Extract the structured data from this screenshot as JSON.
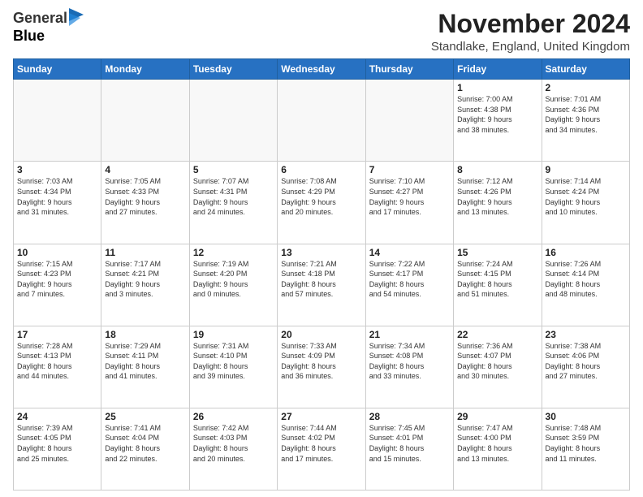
{
  "logo": {
    "general": "General",
    "blue": "Blue"
  },
  "title": "November 2024",
  "location": "Standlake, England, United Kingdom",
  "days_of_week": [
    "Sunday",
    "Monday",
    "Tuesday",
    "Wednesday",
    "Thursday",
    "Friday",
    "Saturday"
  ],
  "weeks": [
    [
      {
        "day": "",
        "info": "",
        "empty": true
      },
      {
        "day": "",
        "info": "",
        "empty": true
      },
      {
        "day": "",
        "info": "",
        "empty": true
      },
      {
        "day": "",
        "info": "",
        "empty": true
      },
      {
        "day": "",
        "info": "",
        "empty": true
      },
      {
        "day": "1",
        "info": "Sunrise: 7:00 AM\nSunset: 4:38 PM\nDaylight: 9 hours\nand 38 minutes."
      },
      {
        "day": "2",
        "info": "Sunrise: 7:01 AM\nSunset: 4:36 PM\nDaylight: 9 hours\nand 34 minutes."
      }
    ],
    [
      {
        "day": "3",
        "info": "Sunrise: 7:03 AM\nSunset: 4:34 PM\nDaylight: 9 hours\nand 31 minutes."
      },
      {
        "day": "4",
        "info": "Sunrise: 7:05 AM\nSunset: 4:33 PM\nDaylight: 9 hours\nand 27 minutes."
      },
      {
        "day": "5",
        "info": "Sunrise: 7:07 AM\nSunset: 4:31 PM\nDaylight: 9 hours\nand 24 minutes."
      },
      {
        "day": "6",
        "info": "Sunrise: 7:08 AM\nSunset: 4:29 PM\nDaylight: 9 hours\nand 20 minutes."
      },
      {
        "day": "7",
        "info": "Sunrise: 7:10 AM\nSunset: 4:27 PM\nDaylight: 9 hours\nand 17 minutes."
      },
      {
        "day": "8",
        "info": "Sunrise: 7:12 AM\nSunset: 4:26 PM\nDaylight: 9 hours\nand 13 minutes."
      },
      {
        "day": "9",
        "info": "Sunrise: 7:14 AM\nSunset: 4:24 PM\nDaylight: 9 hours\nand 10 minutes."
      }
    ],
    [
      {
        "day": "10",
        "info": "Sunrise: 7:15 AM\nSunset: 4:23 PM\nDaylight: 9 hours\nand 7 minutes."
      },
      {
        "day": "11",
        "info": "Sunrise: 7:17 AM\nSunset: 4:21 PM\nDaylight: 9 hours\nand 3 minutes."
      },
      {
        "day": "12",
        "info": "Sunrise: 7:19 AM\nSunset: 4:20 PM\nDaylight: 9 hours\nand 0 minutes."
      },
      {
        "day": "13",
        "info": "Sunrise: 7:21 AM\nSunset: 4:18 PM\nDaylight: 8 hours\nand 57 minutes."
      },
      {
        "day": "14",
        "info": "Sunrise: 7:22 AM\nSunset: 4:17 PM\nDaylight: 8 hours\nand 54 minutes."
      },
      {
        "day": "15",
        "info": "Sunrise: 7:24 AM\nSunset: 4:15 PM\nDaylight: 8 hours\nand 51 minutes."
      },
      {
        "day": "16",
        "info": "Sunrise: 7:26 AM\nSunset: 4:14 PM\nDaylight: 8 hours\nand 48 minutes."
      }
    ],
    [
      {
        "day": "17",
        "info": "Sunrise: 7:28 AM\nSunset: 4:13 PM\nDaylight: 8 hours\nand 44 minutes."
      },
      {
        "day": "18",
        "info": "Sunrise: 7:29 AM\nSunset: 4:11 PM\nDaylight: 8 hours\nand 41 minutes."
      },
      {
        "day": "19",
        "info": "Sunrise: 7:31 AM\nSunset: 4:10 PM\nDaylight: 8 hours\nand 39 minutes."
      },
      {
        "day": "20",
        "info": "Sunrise: 7:33 AM\nSunset: 4:09 PM\nDaylight: 8 hours\nand 36 minutes."
      },
      {
        "day": "21",
        "info": "Sunrise: 7:34 AM\nSunset: 4:08 PM\nDaylight: 8 hours\nand 33 minutes."
      },
      {
        "day": "22",
        "info": "Sunrise: 7:36 AM\nSunset: 4:07 PM\nDaylight: 8 hours\nand 30 minutes."
      },
      {
        "day": "23",
        "info": "Sunrise: 7:38 AM\nSunset: 4:06 PM\nDaylight: 8 hours\nand 27 minutes."
      }
    ],
    [
      {
        "day": "24",
        "info": "Sunrise: 7:39 AM\nSunset: 4:05 PM\nDaylight: 8 hours\nand 25 minutes."
      },
      {
        "day": "25",
        "info": "Sunrise: 7:41 AM\nSunset: 4:04 PM\nDaylight: 8 hours\nand 22 minutes."
      },
      {
        "day": "26",
        "info": "Sunrise: 7:42 AM\nSunset: 4:03 PM\nDaylight: 8 hours\nand 20 minutes."
      },
      {
        "day": "27",
        "info": "Sunrise: 7:44 AM\nSunset: 4:02 PM\nDaylight: 8 hours\nand 17 minutes."
      },
      {
        "day": "28",
        "info": "Sunrise: 7:45 AM\nSunset: 4:01 PM\nDaylight: 8 hours\nand 15 minutes."
      },
      {
        "day": "29",
        "info": "Sunrise: 7:47 AM\nSunset: 4:00 PM\nDaylight: 8 hours\nand 13 minutes."
      },
      {
        "day": "30",
        "info": "Sunrise: 7:48 AM\nSunset: 3:59 PM\nDaylight: 8 hours\nand 11 minutes."
      }
    ]
  ]
}
